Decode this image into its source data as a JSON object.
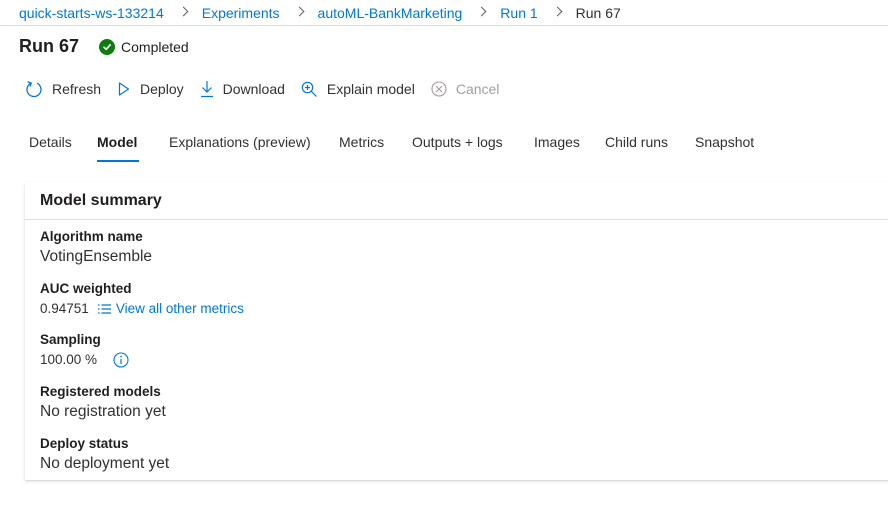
{
  "breadcrumb": {
    "workspace": "quick-starts-ws-133214",
    "experiments": "Experiments",
    "experiment": "autoML-BankMarketing",
    "parent_run": "Run 1",
    "current": "Run 67"
  },
  "header": {
    "title": "Run 67",
    "status": "Completed",
    "status_color": "#107c10"
  },
  "toolbar": {
    "refresh": "Refresh",
    "deploy": "Deploy",
    "download": "Download",
    "explain": "Explain model",
    "cancel": "Cancel"
  },
  "tabs": [
    {
      "label": "Details"
    },
    {
      "label": "Model"
    },
    {
      "label": "Explanations (preview)"
    },
    {
      "label": "Metrics"
    },
    {
      "label": "Outputs + logs"
    },
    {
      "label": "Images"
    },
    {
      "label": "Child runs"
    },
    {
      "label": "Snapshot"
    }
  ],
  "active_tab": "Model",
  "model_summary": {
    "title": "Model summary",
    "algorithm_label": "Algorithm name",
    "algorithm_value": "VotingEnsemble",
    "auc_label": "AUC weighted",
    "auc_value": "0.94751",
    "metrics_link": "View all other metrics",
    "sampling_label": "Sampling",
    "sampling_value": "100.00 %",
    "registered_label": "Registered models",
    "registered_value": "No registration yet",
    "deploy_label": "Deploy status",
    "deploy_value": "No deployment yet"
  },
  "colors": {
    "accent": "#0078d4",
    "text": "#323130",
    "disabled": "#a19f9d"
  }
}
